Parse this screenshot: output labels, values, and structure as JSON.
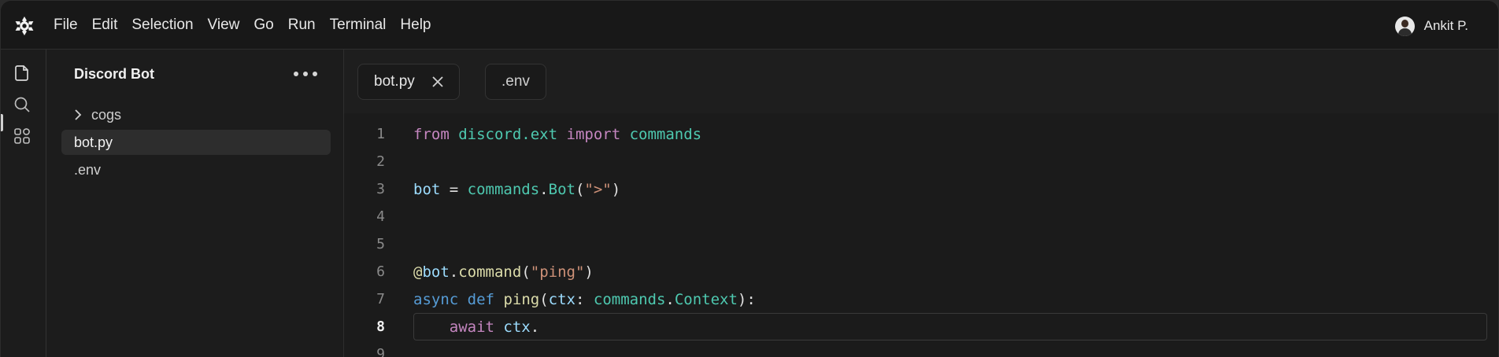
{
  "menu": {
    "items": [
      "File",
      "Edit",
      "Selection",
      "View",
      "Go",
      "Run",
      "Terminal",
      "Help"
    ]
  },
  "user": {
    "name": "Ankit P."
  },
  "explorer": {
    "title": "Discord Bot",
    "items": [
      {
        "label": "cogs",
        "type": "folder"
      },
      {
        "label": "bot.py",
        "type": "file",
        "selected": true
      },
      {
        "label": ".env",
        "type": "file"
      }
    ]
  },
  "tabs": [
    {
      "label": "bot.py",
      "active": true
    },
    {
      "label": ".env",
      "active": false
    }
  ],
  "editor": {
    "active_line": 8,
    "lines": [
      {
        "n": "1",
        "tokens": [
          [
            "kw-purple",
            "from"
          ],
          [
            "punct",
            " "
          ],
          [
            "mod",
            "discord.ext"
          ],
          [
            "punct",
            " "
          ],
          [
            "kw-purple",
            "import"
          ],
          [
            "punct",
            " "
          ],
          [
            "mod",
            "commands"
          ]
        ]
      },
      {
        "n": "2",
        "tokens": []
      },
      {
        "n": "3",
        "tokens": [
          [
            "var",
            "bot"
          ],
          [
            "punct",
            " = "
          ],
          [
            "mod",
            "commands"
          ],
          [
            "punct",
            "."
          ],
          [
            "mod",
            "Bot"
          ],
          [
            "punct",
            "("
          ],
          [
            "str",
            "\">\""
          ],
          [
            "punct",
            ")"
          ]
        ]
      },
      {
        "n": "4",
        "tokens": []
      },
      {
        "n": "5",
        "tokens": []
      },
      {
        "n": "6",
        "tokens": [
          [
            "fn",
            "@"
          ],
          [
            "var",
            "bot"
          ],
          [
            "punct",
            "."
          ],
          [
            "fn",
            "command"
          ],
          [
            "punct",
            "("
          ],
          [
            "str",
            "\"ping\""
          ],
          [
            "punct",
            ")"
          ]
        ]
      },
      {
        "n": "7",
        "tokens": [
          [
            "kw-blue",
            "async"
          ],
          [
            "punct",
            " "
          ],
          [
            "kw-blue",
            "def"
          ],
          [
            "punct",
            " "
          ],
          [
            "fn",
            "ping"
          ],
          [
            "punct",
            "("
          ],
          [
            "var",
            "ctx"
          ],
          [
            "punct",
            ": "
          ],
          [
            "mod",
            "commands"
          ],
          [
            "punct",
            "."
          ],
          [
            "mod",
            "Context"
          ],
          [
            "punct",
            "):"
          ]
        ]
      },
      {
        "n": "8",
        "tokens": [
          [
            "punct",
            "    "
          ],
          [
            "kw-purple",
            "await"
          ],
          [
            "punct",
            " "
          ],
          [
            "var",
            "ctx"
          ],
          [
            "punct",
            "."
          ]
        ]
      },
      {
        "n": "9",
        "tokens": []
      }
    ]
  },
  "colors": {
    "keyword_purple": "#c586c0",
    "keyword_blue": "#569cd6",
    "module": "#4ec9b0",
    "variable": "#9cdcfe",
    "function": "#dcdcaa",
    "string": "#ce9178"
  }
}
